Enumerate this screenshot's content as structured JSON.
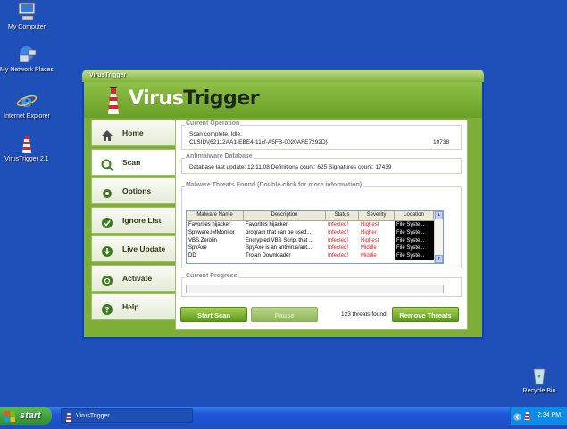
{
  "desktop": {
    "icons": [
      {
        "label": "My Computer",
        "icon": "computer-icon"
      },
      {
        "label": "My Network Places",
        "icon": "network-icon"
      },
      {
        "label": "Internet Explorer",
        "icon": "ie-icon"
      },
      {
        "label": "VirusTrigger 2.1",
        "icon": "lighthouse-icon"
      },
      {
        "label": "Recycle Bin",
        "icon": "recycle-bin-icon"
      }
    ]
  },
  "window": {
    "title": "VirusTrigger",
    "logo": {
      "part1": "Virus",
      "part2": "Trigger"
    }
  },
  "sidebar": {
    "items": [
      {
        "label": "Home",
        "icon": "home-icon"
      },
      {
        "label": "Scan",
        "icon": "scan-icon"
      },
      {
        "label": "Options",
        "icon": "options-icon"
      },
      {
        "label": "Ignore List",
        "icon": "ignore-list-icon"
      },
      {
        "label": "Live Update",
        "icon": "live-update-icon"
      },
      {
        "label": "Activate",
        "icon": "activate-icon"
      },
      {
        "label": "Help",
        "icon": "help-icon"
      }
    ],
    "active": "Scan"
  },
  "current_operation": {
    "title": "Current Operation",
    "status": "Scan complete. Idle.",
    "clsid": "CLSID\\{62112AA1-EBE4-11cf-A5FB-0020AFE7292D}",
    "count": "10738"
  },
  "database": {
    "title": "Antimalware Database",
    "info": "Database last update: 12.11.08 Definitions count: 625 Signatures count: 17439"
  },
  "threats": {
    "title": "Malware Threats Found (Double-click for more information)",
    "columns": [
      "Malware Name",
      "Description",
      "Status",
      "Severity",
      "Location"
    ],
    "rows": [
      [
        "Favorites hijacker",
        "Favorites hijacker",
        "Infected!",
        "Highest",
        "File Syste..."
      ],
      [
        "Spyware.IMMonitor",
        "program that can be used...",
        "Infected!",
        "Higher",
        "File Syste..."
      ],
      [
        "VBS.Zerolin",
        "Encrypted VBS Script that ...",
        "Infected!",
        "Highest",
        "File Syste..."
      ],
      [
        "SpyAxe",
        "SpyAxe is an antivirus/ant...",
        "Infected!",
        "Middle",
        "File Syste..."
      ],
      [
        "DD",
        "Trojan Downloader",
        "Infected!",
        "Middle",
        "File Syste..."
      ]
    ]
  },
  "progress": {
    "title": "Current Progress",
    "value": 0
  },
  "actions": {
    "start_scan": "Start Scan",
    "pause": "Pause",
    "threats_found": "123 threats found",
    "remove_threats": "Remove Threats"
  },
  "taskbar": {
    "start_label": "start",
    "task_title": "VirusTrigger",
    "clock": "2:34 PM"
  },
  "colors": {
    "desktop": "#1f4fb8",
    "accent_green": "#7fae37",
    "infected_red": "#e31b1b"
  }
}
